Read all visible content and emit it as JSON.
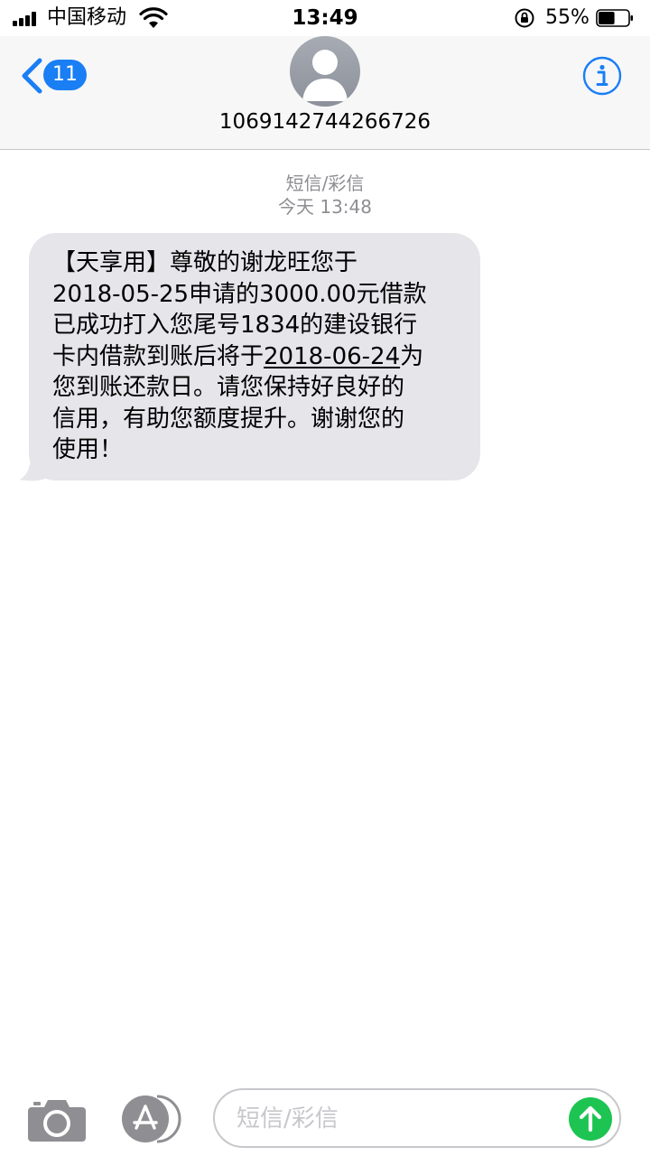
{
  "status_bar": {
    "carrier": "中国移动",
    "time": "13:49",
    "battery_percent": "55%",
    "battery_level": 0.55
  },
  "header": {
    "back_badge_count": "11",
    "contact_name": "1069142744266726"
  },
  "thread": {
    "message_type": "短信/彩信",
    "timestamp": "今天 13:48",
    "message": {
      "line1": "【天享用】尊敬的谢龙旺您于",
      "line2": "2018-05-25申请的3000.00元借款",
      "line3": "已成功打入您尾号1834的建设银行",
      "line4_prefix": "卡内借款到账后将于",
      "line4_link": "2018-06-24",
      "line4_suffix": "为",
      "line5": "您到账还款日。请您保持好良好的",
      "line6": "信用，有助您额度提升。谢谢您的",
      "line7": "使用！"
    }
  },
  "composer": {
    "placeholder": "短信/彩信"
  },
  "colors": {
    "accent_blue": "#1a7ef5",
    "bubble_gray": "#e5e5ea",
    "send_green": "#1dc452",
    "meta_gray": "#8e8e93"
  },
  "icons": [
    "signal-icon",
    "wifi-icon",
    "rotation-lock-icon",
    "battery-icon",
    "back-chevron-icon",
    "avatar-icon",
    "info-icon",
    "camera-icon",
    "app-store-icon",
    "send-arrow-icon"
  ]
}
